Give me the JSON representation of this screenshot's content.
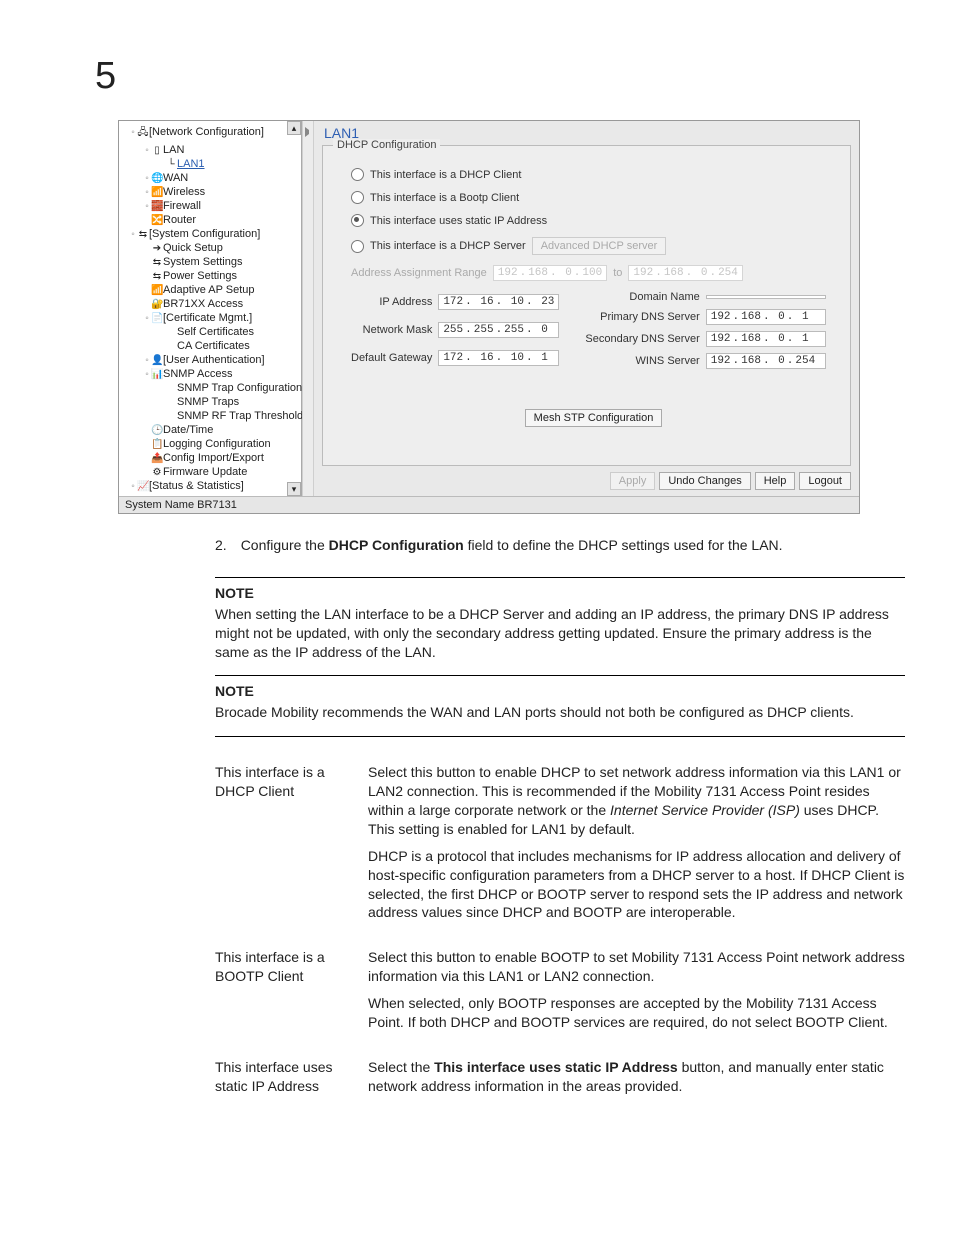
{
  "chapter": "5",
  "gui": {
    "tree": [
      {
        "tog": "◦",
        "icon": "🖧",
        "label": "[Network Configuration]",
        "depth": 0
      },
      {
        "tog": "◦",
        "icon": "▯",
        "label": "LAN",
        "depth": 1
      },
      {
        "tog": "",
        "icon": "└",
        "label": "LAN1",
        "depth": 2,
        "sel": true
      },
      {
        "tog": "◦",
        "icon": "🌐",
        "label": "WAN",
        "depth": 1
      },
      {
        "tog": "◦",
        "icon": "📶",
        "label": "Wireless",
        "depth": 1
      },
      {
        "tog": "◦",
        "icon": "🧱",
        "label": "Firewall",
        "depth": 1
      },
      {
        "tog": "",
        "icon": "🔀",
        "label": "Router",
        "depth": 1
      },
      {
        "tog": "◦",
        "icon": "⇆",
        "label": "[System Configuration]",
        "depth": 0
      },
      {
        "tog": "",
        "icon": "➔",
        "label": "Quick Setup",
        "depth": 1
      },
      {
        "tog": "",
        "icon": "⇆",
        "label": "System Settings",
        "depth": 1
      },
      {
        "tog": "",
        "icon": "⇆",
        "label": "Power Settings",
        "depth": 1
      },
      {
        "tog": "",
        "icon": "📶",
        "label": "Adaptive AP Setup",
        "depth": 1
      },
      {
        "tog": "",
        "icon": "🔐",
        "label": "BR71XX Access",
        "depth": 1
      },
      {
        "tog": "◦",
        "icon": "📄",
        "label": "[Certificate Mgmt.]",
        "depth": 1
      },
      {
        "tog": "",
        "icon": "",
        "label": "Self Certificates",
        "depth": 2
      },
      {
        "tog": "",
        "icon": "",
        "label": "CA Certificates",
        "depth": 2
      },
      {
        "tog": "◦",
        "icon": "👤",
        "label": "[User Authentication]",
        "depth": 1
      },
      {
        "tog": "◦",
        "icon": "📊",
        "label": "SNMP Access",
        "depth": 1
      },
      {
        "tog": "",
        "icon": "",
        "label": "SNMP Trap Configuration",
        "depth": 2
      },
      {
        "tog": "",
        "icon": "",
        "label": "SNMP Traps",
        "depth": 2
      },
      {
        "tog": "",
        "icon": "",
        "label": "SNMP RF Trap Thresholds",
        "depth": 2
      },
      {
        "tog": "",
        "icon": "🕒",
        "label": "Date/Time",
        "depth": 1
      },
      {
        "tog": "",
        "icon": "📋",
        "label": "Logging Configuration",
        "depth": 1
      },
      {
        "tog": "",
        "icon": "📤",
        "label": "Config Import/Export",
        "depth": 1
      },
      {
        "tog": "",
        "icon": "⚙",
        "label": "Firmware Update",
        "depth": 1
      },
      {
        "tog": "◦",
        "icon": "📈",
        "label": "[Status & Statistics]",
        "depth": 0
      }
    ],
    "status_bar": "System Name BR7131",
    "panel": {
      "title": "LAN1",
      "legend": "DHCP Configuration",
      "radios": {
        "dhcp_client": "This interface is a DHCP Client",
        "bootp_client": "This interface is a Bootp Client",
        "static_ip": "This interface uses static IP Address",
        "dhcp_server": "This interface is a DHCP Server"
      },
      "adv_btn": "Advanced DHCP server",
      "addr_range_label": "Address Assignment Range",
      "addr_range_from": [
        "192",
        "168",
        "0",
        "100"
      ],
      "to_label": "to",
      "addr_range_to": [
        "192",
        "168",
        "0",
        "254"
      ],
      "left_fields": {
        "ip_label": "IP Address",
        "ip": [
          "172",
          "16",
          "10",
          "23"
        ],
        "mask_label": "Network Mask",
        "mask": [
          "255",
          "255",
          "255",
          "0"
        ],
        "gw_label": "Default Gateway",
        "gw": [
          "172",
          "16",
          "10",
          "1"
        ]
      },
      "right_fields": {
        "domain_label": "Domain Name",
        "domain": "",
        "pdns_label": "Primary DNS Server",
        "pdns": [
          "192",
          "168",
          "0",
          "1"
        ],
        "sdns_label": "Secondary DNS Server",
        "sdns": [
          "192",
          "168",
          "0",
          "1"
        ],
        "wins_label": "WINS Server",
        "wins": [
          "192",
          "168",
          "0",
          "254"
        ]
      },
      "mesh_btn": "Mesh STP Configuration",
      "buttons": {
        "apply": "Apply",
        "undo": "Undo Changes",
        "help": "Help",
        "logout": "Logout"
      }
    }
  },
  "step": {
    "num": "2.",
    "text_pre": "Configure the ",
    "bold": "DHCP Configuration",
    "text_post": " field to define the DHCP settings used for the LAN."
  },
  "notes": [
    {
      "head": "NOTE",
      "body": "When setting the LAN interface to be a DHCP Server and adding an IP address, the primary DNS IP address might not be updated, with only the secondary address getting updated. Ensure the primary address is the same as the IP address of the LAN."
    },
    {
      "head": "NOTE",
      "body": "Brocade Mobility recommends the WAN and LAN ports should not both be configured as DHCP clients."
    }
  ],
  "params": [
    {
      "term": "This interface is a DHCP Client",
      "desc": [
        {
          "pre": "Select this button to enable DHCP to set network address information via this LAN1 or LAN2 connection. This is recommended if the Mobility 7131 Access Point resides within a large corporate network or the ",
          "ital": "Internet Service Provider (ISP)",
          "post": " uses DHCP. This setting is enabled for LAN1 by default."
        },
        {
          "pre": "DHCP is a protocol that includes mechanisms for IP address allocation and delivery of host-specific configuration parameters from a DHCP server to a host. If DHCP Client is selected, the first DHCP or BOOTP server to respond sets the IP address and network address values since DHCP and BOOTP are interoperable.",
          "ital": "",
          "post": ""
        }
      ]
    },
    {
      "term": "This interface is a BOOTP Client",
      "desc": [
        {
          "pre": "Select this button to enable BOOTP to set Mobility 7131 Access Point network address information via this LAN1 or LAN2 connection.",
          "ital": "",
          "post": ""
        },
        {
          "pre": "When selected, only BOOTP responses are accepted by the Mobility 7131 Access Point. If both DHCP and BOOTP services are required, do not select BOOTP Client.",
          "ital": "",
          "post": ""
        }
      ]
    },
    {
      "term": "This interface uses static IP Address",
      "desc": [
        {
          "pre": "Select the ",
          "bold": "This interface uses static IP Address",
          "post": " button, and manually enter static network address information in the areas provided."
        }
      ]
    }
  ]
}
